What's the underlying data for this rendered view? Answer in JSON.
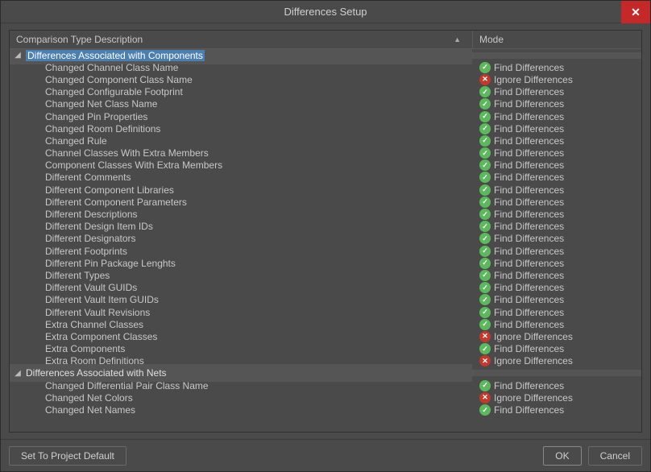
{
  "title": "Differences Setup",
  "columns": {
    "desc": "Comparison Type Description",
    "mode": "Mode"
  },
  "mode_labels": {
    "find": "Find Differences",
    "ignore": "Ignore Differences"
  },
  "buttons": {
    "default": "Set To Project Default",
    "ok": "OK",
    "cancel": "Cancel"
  },
  "groups": [
    {
      "label": "Differences Associated with Components",
      "selected": true,
      "items": [
        {
          "label": "Changed Channel Class Name",
          "mode": "find"
        },
        {
          "label": "Changed Component Class Name",
          "mode": "ignore"
        },
        {
          "label": "Changed Configurable Footprint",
          "mode": "find"
        },
        {
          "label": "Changed Net Class Name",
          "mode": "find"
        },
        {
          "label": "Changed Pin Properties",
          "mode": "find"
        },
        {
          "label": "Changed Room Definitions",
          "mode": "find"
        },
        {
          "label": "Changed Rule",
          "mode": "find"
        },
        {
          "label": "Channel Classes With Extra Members",
          "mode": "find"
        },
        {
          "label": "Component Classes With Extra Members",
          "mode": "find"
        },
        {
          "label": "Different Comments",
          "mode": "find"
        },
        {
          "label": "Different Component Libraries",
          "mode": "find"
        },
        {
          "label": "Different Component Parameters",
          "mode": "find"
        },
        {
          "label": "Different Descriptions",
          "mode": "find"
        },
        {
          "label": "Different Design Item IDs",
          "mode": "find"
        },
        {
          "label": "Different Designators",
          "mode": "find"
        },
        {
          "label": "Different Footprints",
          "mode": "find"
        },
        {
          "label": "Different Pin Package Lenghts",
          "mode": "find"
        },
        {
          "label": "Different Types",
          "mode": "find"
        },
        {
          "label": "Different Vault GUIDs",
          "mode": "find"
        },
        {
          "label": "Different Vault Item GUIDs",
          "mode": "find"
        },
        {
          "label": "Different Vault Revisions",
          "mode": "find"
        },
        {
          "label": "Extra Channel Classes",
          "mode": "find"
        },
        {
          "label": "Extra Component Classes",
          "mode": "ignore"
        },
        {
          "label": "Extra Components",
          "mode": "find"
        },
        {
          "label": "Extra Room Definitions",
          "mode": "ignore"
        }
      ]
    },
    {
      "label": "Differences Associated with Nets",
      "selected": false,
      "items": [
        {
          "label": "Changed Differential Pair Class Name",
          "mode": "find"
        },
        {
          "label": "Changed Net Colors",
          "mode": "ignore"
        },
        {
          "label": "Changed Net Names",
          "mode": "find"
        }
      ]
    }
  ]
}
